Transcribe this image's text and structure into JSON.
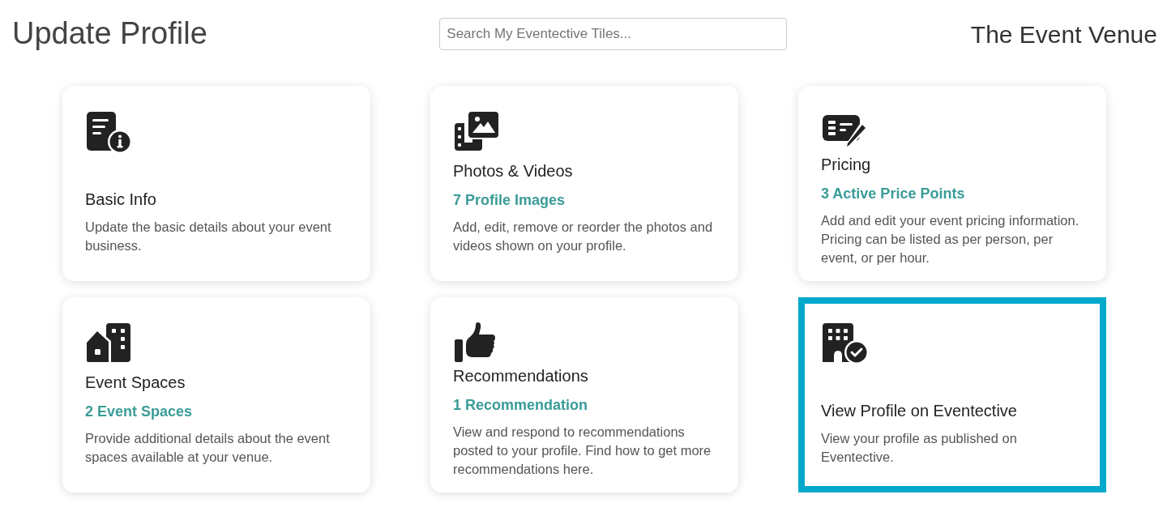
{
  "header": {
    "title": "Update Profile",
    "search": {
      "placeholder": "Search My Eventective Tiles..."
    },
    "venue": "The Event Venue"
  },
  "tiles": [
    {
      "kind": "info",
      "title": "Basic Info",
      "description": "Update the basic details about your event business.",
      "selected": false
    },
    {
      "kind": "media",
      "title": "Photos & Videos",
      "subtitle": "7 Profile Images",
      "description": "Add, edit, remove or reorder the photos and videos shown on your profile.",
      "selected": false
    },
    {
      "kind": "pricing",
      "title": "Pricing",
      "subtitle": "3 Active Price Points",
      "description": "Add and edit your event pricing information. Pricing can be listed as per person, per event, or per hour.",
      "selected": false
    },
    {
      "kind": "spaces",
      "title": "Event Spaces",
      "subtitle": "2 Event Spaces",
      "description": "Provide additional details about the event spaces available at your venue.",
      "selected": false
    },
    {
      "kind": "recommendations",
      "title": "Recommendations",
      "subtitle": "1 Recommendation",
      "description": "View and respond to recommendations posted to your profile. Find how to get more recommendations here.",
      "selected": false
    },
    {
      "kind": "profile",
      "title": "View Profile on Eventective",
      "description": "View your profile as published on Eventective.",
      "selected": true
    }
  ]
}
